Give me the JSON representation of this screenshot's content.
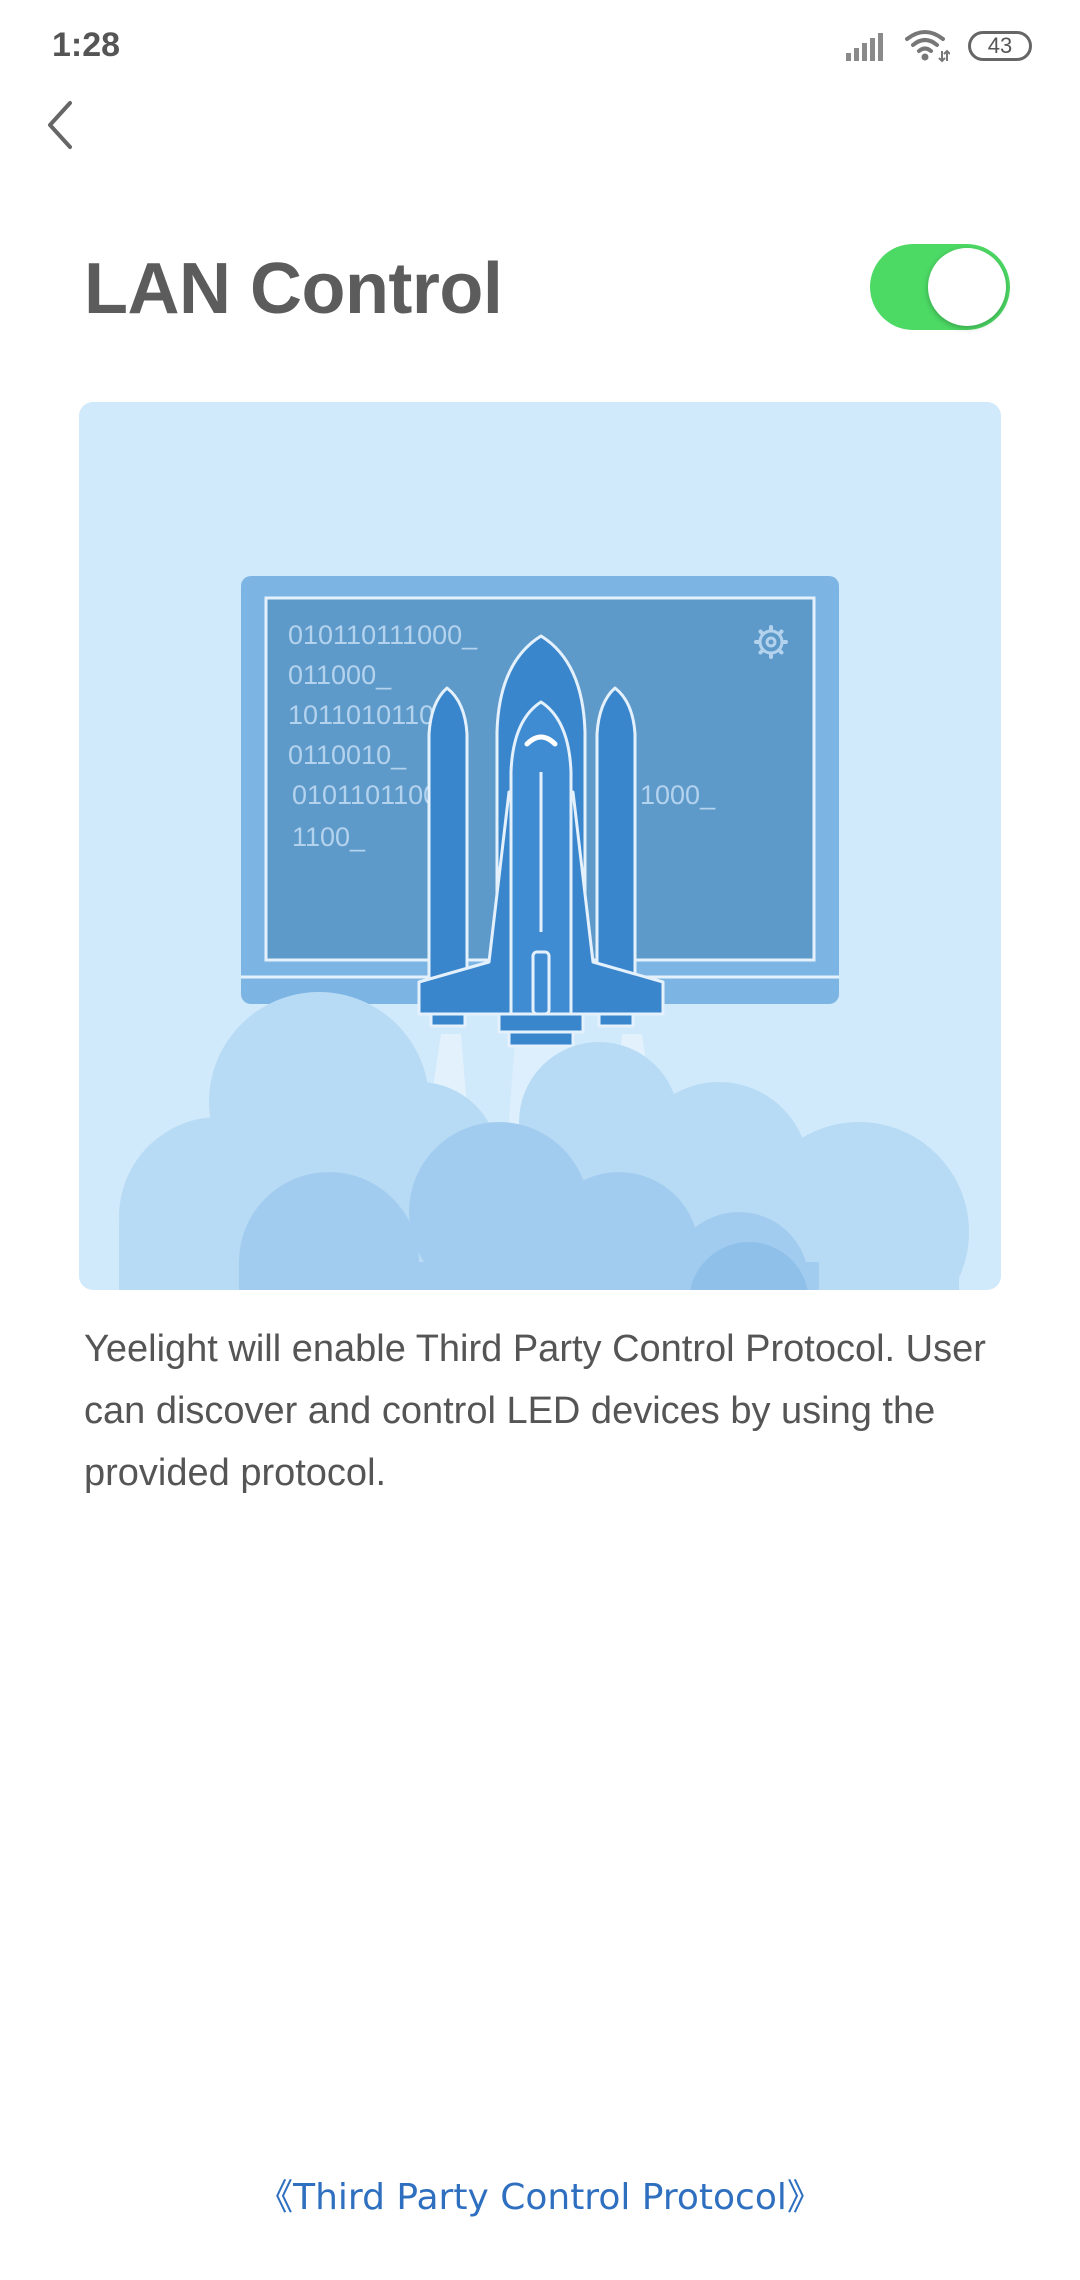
{
  "status_bar": {
    "time": "1:28",
    "battery_level": "43",
    "icons": [
      "signal-icon",
      "wifi-icon",
      "battery-icon"
    ]
  },
  "header": {
    "back_icon": "chevron-left-icon",
    "title": "LAN Control"
  },
  "lan_toggle": {
    "state": "on",
    "color_on": "#4cd964"
  },
  "illustration": {
    "binary_lines": [
      "010110111000_",
      "011000_",
      "1011010110",
      "0110010_",
      "0101101100",
      "1100_"
    ],
    "binary_right": "1000_",
    "background_color": "#d0e9fb"
  },
  "description": {
    "text": "Yeelight will enable Third Party Control Protocol. User can discover and control LED devices by using the provided protocol."
  },
  "footer": {
    "link_label": "《Third Party Control Protocol》",
    "link_color": "#2f6fc0"
  }
}
